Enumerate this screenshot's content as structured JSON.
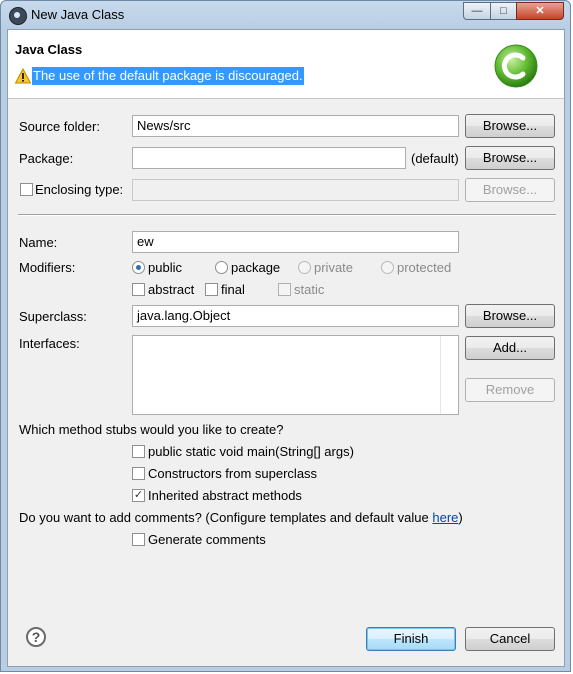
{
  "window": {
    "title": "New Java Class"
  },
  "banner": {
    "title": "Java Class",
    "message": "The use of the default package is discouraged."
  },
  "form": {
    "source_folder": {
      "label": "Source folder:",
      "value": "News/src",
      "browse_label": "Browse..."
    },
    "package": {
      "label": "Package:",
      "value": "",
      "suffix": "(default)",
      "browse_label": "Browse..."
    },
    "enclosing_type": {
      "label": "Enclosing type:",
      "value": "",
      "checked": false,
      "browse_label": "Browse..."
    },
    "name": {
      "label": "Name:",
      "value": "ew"
    },
    "modifiers": {
      "label": "Modifiers:",
      "access": [
        {
          "label": "public",
          "selected": true,
          "enabled": true
        },
        {
          "label": "package",
          "selected": false,
          "enabled": true
        },
        {
          "label": "private",
          "selected": false,
          "enabled": false
        },
        {
          "label": "protected",
          "selected": false,
          "enabled": false
        }
      ],
      "flags": [
        {
          "label": "abstract",
          "checked": false,
          "enabled": true
        },
        {
          "label": "final",
          "checked": false,
          "enabled": true
        },
        {
          "label": "static",
          "checked": false,
          "enabled": false
        }
      ]
    },
    "superclass": {
      "label": "Superclass:",
      "value": "java.lang.Object",
      "browse_label": "Browse..."
    },
    "interfaces": {
      "label": "Interfaces:",
      "add_label": "Add...",
      "remove_label": "Remove"
    },
    "stubs": {
      "question": "Which method stubs would you like to create?",
      "options": [
        {
          "label": "public static void main(String[] args)",
          "checked": false
        },
        {
          "label": "Constructors from superclass",
          "checked": false
        },
        {
          "label": "Inherited abstract methods",
          "checked": true
        }
      ]
    },
    "comments": {
      "question_prefix": "Do you want to add comments? (Configure templates and default value ",
      "link": "here",
      "question_suffix": ")",
      "option": {
        "label": "Generate comments",
        "checked": false
      }
    }
  },
  "footer": {
    "finish_label": "Finish",
    "cancel_label": "Cancel",
    "help_glyph": "?"
  },
  "icons": [
    "eclipse-app-icon",
    "warning-icon",
    "java-class-logo-icon",
    "help-icon"
  ],
  "colors": {
    "highlight": "#3399ff",
    "logo_green": "#4aa82a",
    "link": "#0645ad"
  }
}
